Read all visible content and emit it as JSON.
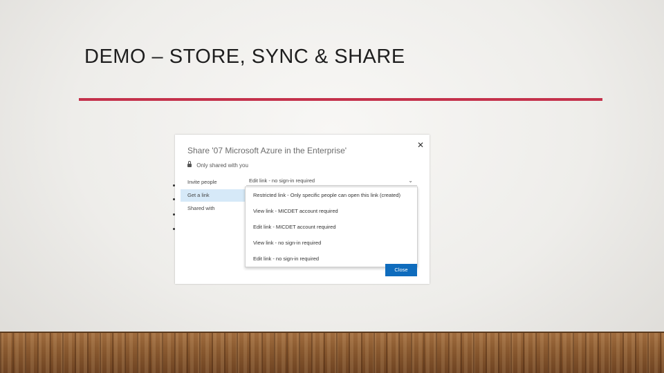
{
  "slide": {
    "title": "DEMO – STORE, SYNC & SHARE",
    "accent_color": "#c4314b"
  },
  "dialog": {
    "title": "Share '07 Microsoft Azure in the Enterprise'",
    "scope_text": "Only shared with you",
    "close_icon": "close-icon",
    "nav_items": [
      {
        "label": "Invite people",
        "selected": false
      },
      {
        "label": "Get a link",
        "selected": true
      },
      {
        "label": "Shared with",
        "selected": false
      }
    ],
    "link_type_selected": "Edit link - no sign-in required",
    "link_type_options": [
      "Restricted link - Only specific people can open this link (created)",
      "View link - MICDET account required",
      "Edit link - MICDET account required",
      "View link - no sign-in required",
      "Edit link - no sign-in required"
    ],
    "close_button_label": "Close",
    "button_color": "#0f6cbd"
  }
}
